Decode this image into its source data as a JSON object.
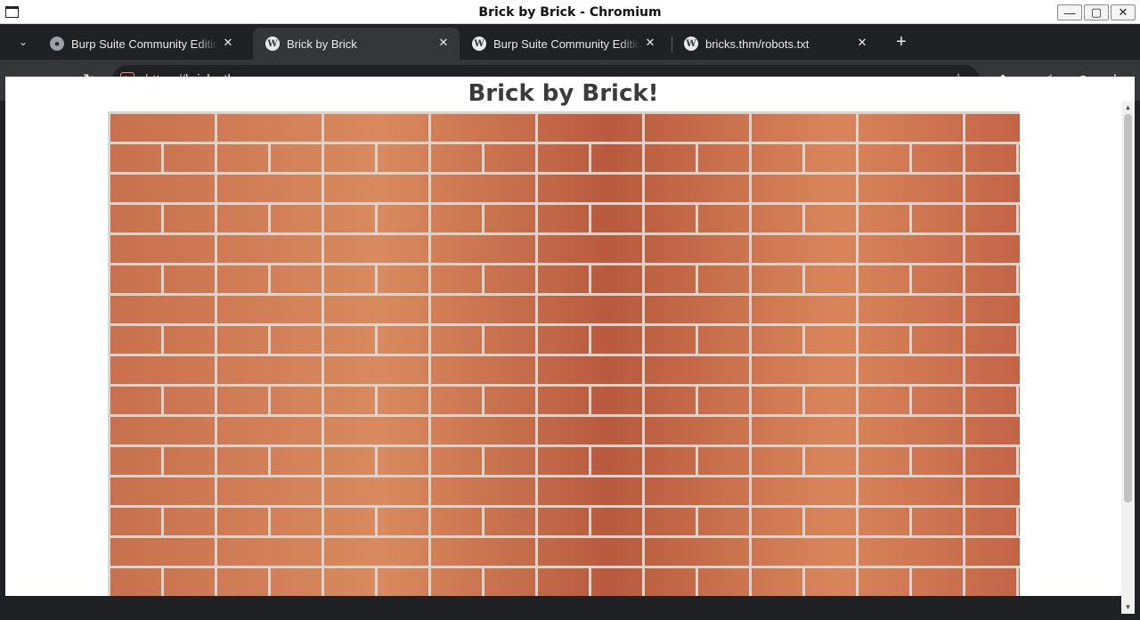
{
  "window": {
    "title": "Brick by Brick - Chromium",
    "controls": [
      "minimize-icon",
      "maximize-icon",
      "close-icon"
    ]
  },
  "tabs": [
    {
      "title": "Burp Suite Community Edition",
      "icon": "globe-icon",
      "active": false
    },
    {
      "title": "Brick by Brick",
      "icon": "wordpress-icon",
      "active": true
    },
    {
      "title": "Burp Suite Community Edition",
      "icon": "wordpress-icon",
      "active": false
    },
    {
      "title": "bricks.thm/robots.txt",
      "icon": "wordpress-icon",
      "active": false
    }
  ],
  "toolbar": {
    "url_scheme": "https",
    "url_separator": "://",
    "url_host": "bricks.thm",
    "security_state": "not-secure"
  },
  "page": {
    "heading": "Brick by Brick!",
    "image": "brick-wall"
  },
  "colors": {
    "frame": "#202124",
    "toolbar": "#35363a",
    "insecure": "#f28b6b",
    "heading": "#3b3b3b"
  }
}
